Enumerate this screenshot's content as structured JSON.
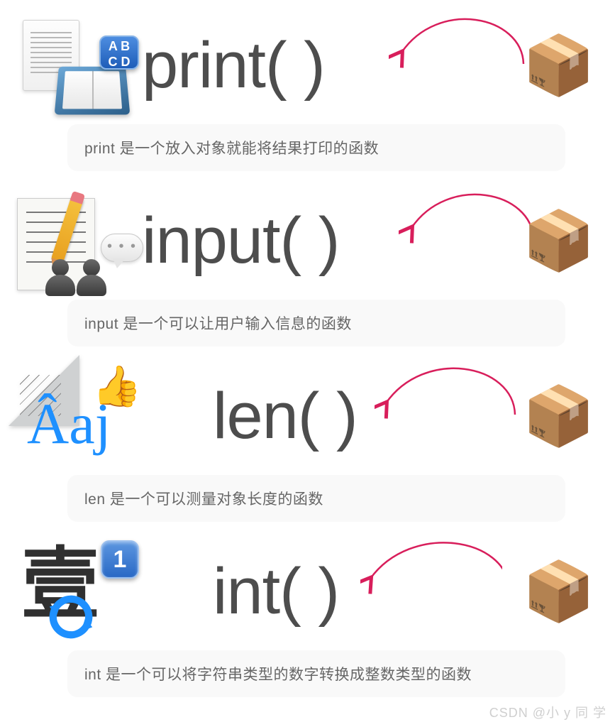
{
  "functions": [
    {
      "name": "print",
      "signature": "print(      )",
      "caption": "print 是一个放入对象就能将结果打印的函数"
    },
    {
      "name": "input",
      "signature": "input(      )",
      "caption": "input 是一个可以让用户输入信息的函数"
    },
    {
      "name": "len",
      "signature": "len(      )",
      "caption": "len 是一个可以测量对象长度的函数"
    },
    {
      "name": "int",
      "signature": "int(      )",
      "caption": "int 是一个可以将字符串类型的数字转换成整数类型的函数"
    }
  ],
  "icon_badges": {
    "abcd": "A B\nC D",
    "one": "1"
  },
  "aaj_text": "Âaj",
  "yi_text": "壹",
  "box_emoji": "📦",
  "thumb_emoji": "👍",
  "watermark": "CSDN @小 y 同 学",
  "arrow_color": "#d81e5b"
}
